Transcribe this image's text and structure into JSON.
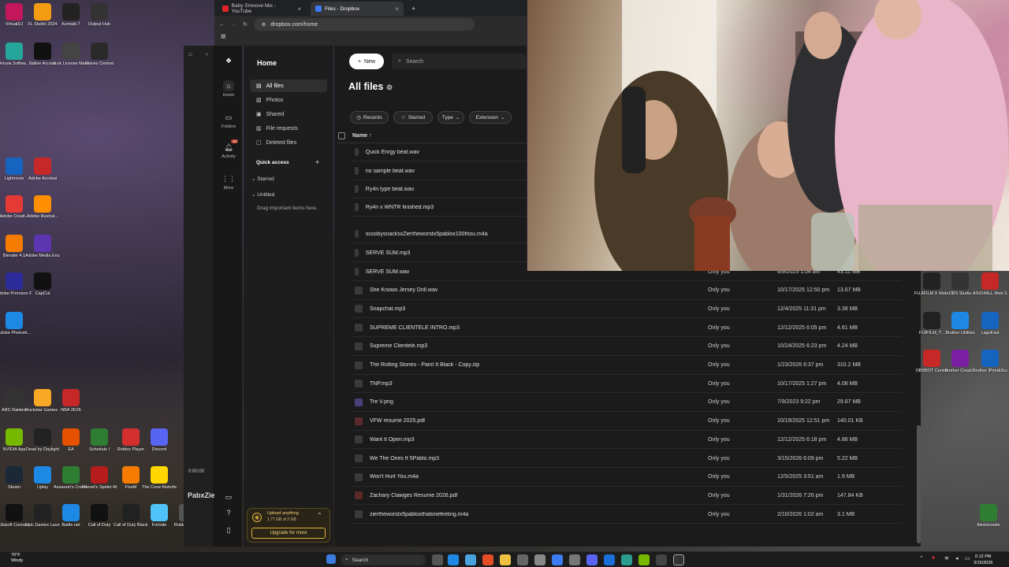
{
  "browser": {
    "tabs": [
      {
        "title": "Baby Smoove Mix - YouTube",
        "active": false
      },
      {
        "title": "Files - Dropbox",
        "active": true
      }
    ],
    "new_tab": "+",
    "url": "dropbox.com/home"
  },
  "rail": [
    {
      "label": "Home",
      "icon": "home-icon"
    },
    {
      "label": "Folders",
      "icon": "folder-icon"
    },
    {
      "label": "Activity",
      "icon": "bell-icon",
      "badge": "10"
    },
    {
      "label": "More",
      "icon": "grid-icon"
    }
  ],
  "sidebar": {
    "header": "Home",
    "items": [
      "All files",
      "Photos",
      "Shared",
      "File requests",
      "Deleted files"
    ],
    "quick_access": "Quick access",
    "starred": "Starred",
    "untitled": "Untitled",
    "drag_hint": "Drag important items here.",
    "upload_title": "Upload anything",
    "upload_usage": "1.77 GB of 2 GB",
    "upgrade": "Upgrade for more"
  },
  "toolbar": {
    "new_label": "New",
    "search_placeholder": "Search"
  },
  "page_title": "All files",
  "filters": [
    "Recents",
    "Starred",
    "Type",
    "Extension"
  ],
  "table_header": {
    "name": "Name"
  },
  "files_top": [
    "Quick Enrgy beat.wav",
    "rio sample beat.wav",
    "Ry4n type beat.wav",
    "Ry4n x WNTR finished.mp3",
    "scoobysnacksxZiertheworstx5pablox100thou.m4a",
    "SERVE SUM.mp3",
    "SERVE SUM.wav"
  ],
  "files": [
    {
      "name": "",
      "shared": "Only you",
      "modified": "6/9/2025 1:04 am",
      "size": "43.11 MB"
    },
    {
      "name": "She Knows Jersey Drill.wav",
      "shared": "Only you",
      "modified": "10/17/2025 12:50 pm",
      "size": "13.67 MB"
    },
    {
      "name": "Snapchat.mp3",
      "shared": "Only you",
      "modified": "12/4/2025 11:31 pm",
      "size": "3.38 MB"
    },
    {
      "name": "SUPREME CLIENTELE INTRO.mp3",
      "shared": "Only you",
      "modified": "12/12/2025 6:05 pm",
      "size": "4.61 MB"
    },
    {
      "name": "Supreme Clientele.mp3",
      "shared": "Only you",
      "modified": "10/24/2025 6:23 pm",
      "size": "4.24 MB"
    },
    {
      "name": "The Rolling Stones - Paint It Black - Copy.zip",
      "shared": "Only you",
      "modified": "1/23/2026 6:37 pm",
      "size": "310.2 MB"
    },
    {
      "name": "TNP.mp3",
      "shared": "Only you",
      "modified": "10/17/2025 1:27 pm",
      "size": "4.08 MB"
    },
    {
      "name": "Tre V.png",
      "shared": "Only you",
      "modified": "7/9/2023 9:22 pm",
      "size": "29.87 MB"
    },
    {
      "name": "VFW resume 2025.pdf",
      "shared": "Only you",
      "modified": "10/19/2025 12:51 pm",
      "size": "140.01 KB"
    },
    {
      "name": "Want It Open.mp3",
      "shared": "Only you",
      "modified": "12/12/2025 6:18 pm",
      "size": "4.88 MB"
    },
    {
      "name": "We The Ones ft 5Pablo.mp3",
      "shared": "Only you",
      "modified": "3/15/2026 6:09 pm",
      "size": "5.22 MB"
    },
    {
      "name": "Won't Hurt You.m4a",
      "shared": "Only you",
      "modified": "12/5/2025 3:51 am",
      "size": "1.9 MB"
    },
    {
      "name": "Zachary Clawges Resume 2026.pdf",
      "shared": "Only you",
      "modified": "1/31/2026 7:26 pm",
      "size": "147.84 KB"
    },
    {
      "name": "ziertheworstx5pabloxthatonefeeling.m4a",
      "shared": "Only you",
      "modified": "2/10/2026 1:02 am",
      "size": "3.1 MB"
    }
  ],
  "desktop_left": [
    "VirtualDJ",
    "FL Studio 2024",
    "Kontakt 7",
    "Output Hub",
    "Arturia Softwa...",
    "Native Access",
    "iLok License Manager",
    "Waves Central",
    "Lightroom",
    "Adobe Acrobat",
    "Adobe Creati...",
    "Adobe Illustrat...",
    "Blender 4.1",
    "Adobe Media Encoder - Sl...",
    "Adobe Premiere P...",
    "CapCut",
    "Adobe Photosh...",
    "ARC Raiders",
    "Rockstar Games ...",
    "NBA 2K26",
    "NVIDIA App",
    "Dead by Daylight",
    "EA",
    "Schedule I",
    "Roblox Player",
    "Discord",
    "Steam",
    "Uplay",
    "Assassin's Creed V...",
    "Marvel's Spider-M...",
    "FiveM",
    "The Crew Motorfest",
    "Ubisoft Connect",
    "Epic Games Launcher",
    "Battle.net",
    "Call of Duty",
    "Call of Duty Black Ops...",
    "Fortnite",
    "Roblox Studio"
  ],
  "desktop_right": [
    "FUJIFILM X Webcam 2",
    "OBS Studio",
    "ASIO4ALL Web Site",
    "FIJIFILM_T...",
    "Brother Utilities",
    "LagoFast",
    "OBSBOT Center",
    "Brother Creati...",
    "Brother iPrint&Scan",
    "thinkorswim"
  ],
  "float_panel": {
    "time": "0:00:00",
    "label": "PabxZie"
  },
  "taskbar": {
    "weather_temp": "70°F",
    "weather_desc": "Windy",
    "search": "Search",
    "time": "6:12 PM",
    "date": "3/15/2026"
  }
}
